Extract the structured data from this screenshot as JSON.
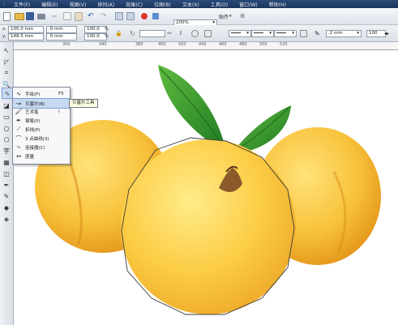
{
  "menubar": {
    "items": [
      "文件(F)",
      "编辑(E)",
      "视图(V)",
      "排列(A)",
      "效果(C)",
      "位图(B)",
      "文本(X)",
      "工具(O)",
      "窗口(W)",
      "帮助(H)"
    ]
  },
  "toolbar": {
    "zoom_value": "200%",
    "snap_label": "贴齐"
  },
  "property_bar": {
    "x": "105.0 mm",
    "y": "148.5 mm",
    "w": ".0 mm",
    "h": ".0 mm",
    "scale_x": "100.0",
    "scale_y": "100.0",
    "pct": "%",
    "outline_width": ".2 mm",
    "smooth": "100"
  },
  "ruler": {
    "ticks": [
      "300",
      "340",
      "380",
      "400",
      "420",
      "440",
      "460",
      "480",
      "500",
      "520"
    ]
  },
  "flyout": {
    "items": [
      {
        "label": "手绘(F)",
        "key": "F5"
      },
      {
        "label": "贝塞尔(B)",
        "key": ""
      },
      {
        "label": "艺术笔",
        "key": "I"
      },
      {
        "label": "钢笔(P)",
        "key": ""
      },
      {
        "label": "折线(P)",
        "key": ""
      },
      {
        "label": "3 点曲线(3)",
        "key": ""
      },
      {
        "label": "连接器(C)",
        "key": ""
      },
      {
        "label": "度量",
        "key": ""
      }
    ]
  },
  "tooltip": {
    "text": "贝塞尔工具"
  }
}
